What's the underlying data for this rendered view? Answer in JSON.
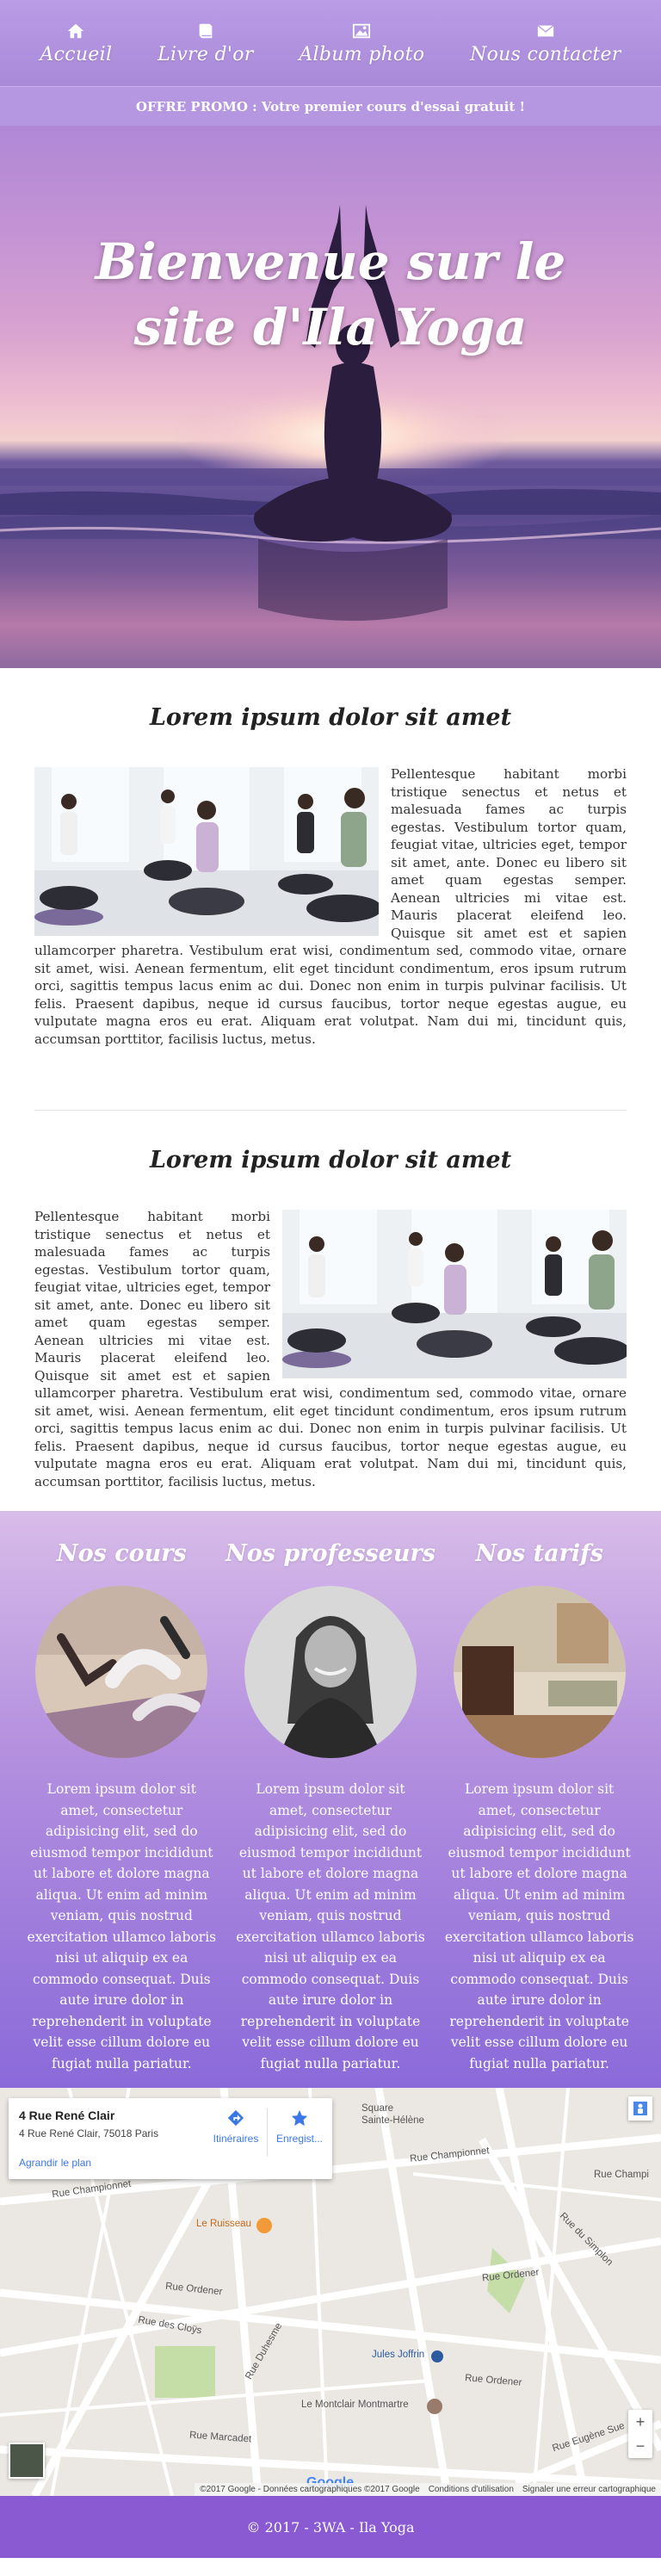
{
  "nav": {
    "items": [
      {
        "label": "Accueil",
        "icon": "home-icon"
      },
      {
        "label": "Livre d'or",
        "icon": "book-icon"
      },
      {
        "label": "Album photo",
        "icon": "picture-icon"
      },
      {
        "label": "Nous contacter",
        "icon": "envelope-icon"
      }
    ]
  },
  "promo": {
    "text": "OFFRE PROMO : Votre premier cours d'essai gratuit !"
  },
  "hero": {
    "title": "Bienvenue sur le site d'Ila Yoga"
  },
  "articles": [
    {
      "title": "Lorem ipsum dolor sit amet",
      "body": "Pellentesque habitant morbi tristique senectus et netus et malesuada fames ac turpis egestas. Vestibulum tortor quam, feugiat vitae, ultricies eget, tempor sit amet, ante. Donec eu libero sit amet quam egestas semper. Aenean ultricies mi vitae est. Mauris placerat eleifend leo. Quisque sit amet est et sapien ullamcorper pharetra. Vestibulum erat wisi, condimentum sed, commodo vitae, ornare sit amet, wisi. Aenean fermentum, elit eget tincidunt condimentum, eros ipsum rutrum orci, sagittis tempus lacus enim ac dui. Donec non enim in turpis pulvinar facilisis. Ut felis. Praesent dapibus, neque id cursus faucibus, tortor neque egestas augue, eu vulputate magna eros eu erat. Aliquam erat volutpat. Nam dui mi, tincidunt quis, accumsan porttitor, facilisis luctus, metus."
    },
    {
      "title": "Lorem ipsum dolor sit amet",
      "body": "Pellentesque habitant morbi tristique senectus et netus et malesuada fames ac turpis egestas. Vestibulum tortor quam, feugiat vitae, ultricies eget, tempor sit amet, ante. Donec eu libero sit amet quam egestas semper. Aenean ultricies mi vitae est. Mauris placerat eleifend leo. Quisque sit amet est et sapien ullamcorper pharetra. Vestibulum erat wisi, condimentum sed, commodo vitae, ornare sit amet, wisi. Aenean fermentum, elit eget tincidunt condimentum, eros ipsum rutrum orci, sagittis tempus lacus enim ac dui. Donec non enim in turpis pulvinar facilisis. Ut felis. Praesent dapibus, neque id cursus faucibus, tortor neque egestas augue, eu vulputate magna eros eu erat. Aliquam erat volutpat. Nam dui mi, tincidunt quis, accumsan porttitor, facilisis luctus, metus."
    }
  ],
  "services": [
    {
      "title": "Nos cours",
      "text": "Lorem ipsum dolor sit amet, consectetur adipisicing elit, sed do eiusmod tempor incididunt ut labore et dolore magna aliqua. Ut enim ad minim veniam, quis nostrud exercitation ullamco laboris nisi ut aliquip ex ea commodo consequat. Duis aute irure dolor in reprehenderit in voluptate velit esse cillum dolore eu fugiat nulla pariatur."
    },
    {
      "title": "Nos professeurs",
      "text": "Lorem ipsum dolor sit amet, consectetur adipisicing elit, sed do eiusmod tempor incididunt ut labore et dolore magna aliqua. Ut enim ad minim veniam, quis nostrud exercitation ullamco laboris nisi ut aliquip ex ea commodo consequat. Duis aute irure dolor in reprehenderit in voluptate velit esse cillum dolore eu fugiat nulla pariatur."
    },
    {
      "title": "Nos tarifs",
      "text": "Lorem ipsum dolor sit amet, consectetur adipisicing elit, sed do eiusmod tempor incididunt ut labore et dolore magna aliqua. Ut enim ad minim veniam, quis nostrud exercitation ullamco laboris nisi ut aliquip ex ea commodo consequat. Duis aute irure dolor in reprehenderit in voluptate velit esse cillum dolore eu fugiat nulla pariatur."
    }
  ],
  "map": {
    "card_title": "4 Rue René Clair",
    "card_address": "4 Rue René Clair, 75018 Paris",
    "card_link": "Agrandir le plan",
    "directions_label": "Itinéraires",
    "save_label": "Enregist...",
    "attribution": "©2017 Google - Données cartographiques ©2017 Google",
    "terms": "Conditions d'utilisation",
    "report": "Signaler une erreur cartographique",
    "google_logo": "Google",
    "zoom_in": "+",
    "zoom_out": "−",
    "labels": {
      "square": "Square",
      "sainte_helene": "Sainte-Hélène",
      "championnet_1": "Rue Championnet",
      "championnet_2": "Rue Championnet",
      "ruisseau": "Le Ruisseau",
      "ordener_1": "Rue Ordener",
      "ordener_2": "Rue Ordener",
      "ordener_3": "Rue Ordener",
      "cloys": "Rue des Cloÿs",
      "duhesme": "Rue Duhesme",
      "jules_joffrin": "Jules Joffrin",
      "montcalm": "Le Montclair Montmartre",
      "marcadet": "Rue Marcadet",
      "simplon": "Rue du Simplon",
      "eugene_sue": "Rue Eugène Sue",
      "championnet_3": "Rue Champi"
    }
  },
  "footer": {
    "text": "© 2017 - 3WA - Ila Yoga"
  },
  "colors": {
    "nav": "#b99be6",
    "promo": "#b596e0",
    "footer": "#8a5ad3",
    "link": "#3b78e7"
  }
}
